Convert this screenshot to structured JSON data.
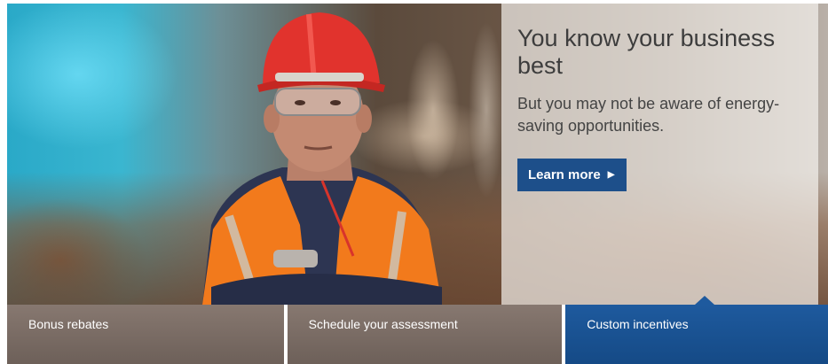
{
  "hero": {
    "title": "You know your business best",
    "subtitle": "But you may not be aware of energy-saving opportunities.",
    "cta_label": "Learn more",
    "cta_icon": "play-arrow-icon",
    "accent_color": "#1d4f8a"
  },
  "tabs": [
    {
      "label": "Bonus rebates",
      "active": false
    },
    {
      "label": "Schedule your assessment",
      "active": false
    },
    {
      "label": "Custom incentives",
      "active": true
    }
  ]
}
